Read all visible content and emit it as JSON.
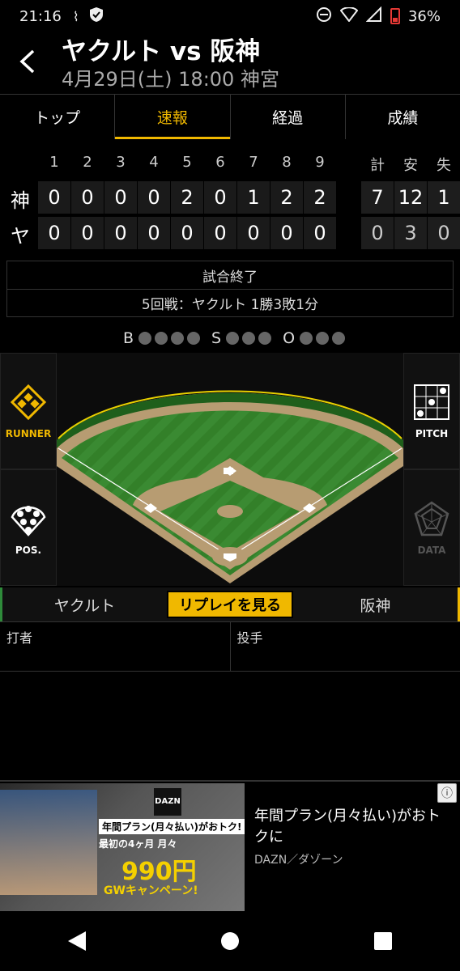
{
  "status_bar": {
    "time": "21:16",
    "battery": "36%"
  },
  "header": {
    "title": "ヤクルト vs 阪神",
    "subtitle": "4月29日(土) 18:00 神宮"
  },
  "tabs": [
    {
      "label": "トップ",
      "active": false
    },
    {
      "label": "速報",
      "active": true
    },
    {
      "label": "経過",
      "active": false
    },
    {
      "label": "成績",
      "active": false
    }
  ],
  "scoreboard": {
    "innings": [
      "1",
      "2",
      "3",
      "4",
      "5",
      "6",
      "7",
      "8",
      "9"
    ],
    "total_headers": [
      "計",
      "安",
      "失"
    ],
    "teams": [
      {
        "name": "神",
        "scores": [
          "0",
          "0",
          "0",
          "0",
          "2",
          "0",
          "1",
          "2",
          "2"
        ],
        "totals": [
          "7",
          "12",
          "1"
        ]
      },
      {
        "name": "ヤ",
        "scores": [
          "0",
          "0",
          "0",
          "0",
          "0",
          "0",
          "0",
          "0",
          "0"
        ],
        "totals": [
          "0",
          "3",
          "0"
        ]
      }
    ]
  },
  "game_status": {
    "state": "試合終了",
    "series": "5回戦：ヤクルト 1勝3敗1分"
  },
  "bso": {
    "b_label": "B",
    "s_label": "S",
    "o_label": "O",
    "balls": 0,
    "strikes": 0,
    "outs": 0
  },
  "side_buttons": {
    "runner": "RUNNER",
    "pitch": "PITCH",
    "pos": "POS.",
    "data": "DATA"
  },
  "team_switch": {
    "home": "ヤクルト",
    "replay": "リプレイを見る",
    "away": "阪神"
  },
  "batter_pitcher": {
    "batter_label": "打者",
    "pitcher_label": "投手"
  },
  "ad": {
    "logo": "DAZN",
    "line1": "年間プラン(月々払い)がおトク!",
    "line2": "最初の4ヶ月 月々",
    "price": "990円",
    "gw": "GWキャンペーン!",
    "title": "年間プラン(月々払い)がおトクに",
    "source": "DAZN／ダゾーン"
  },
  "colors": {
    "accent": "#f0b800",
    "home_color": "#2e8b3a"
  }
}
